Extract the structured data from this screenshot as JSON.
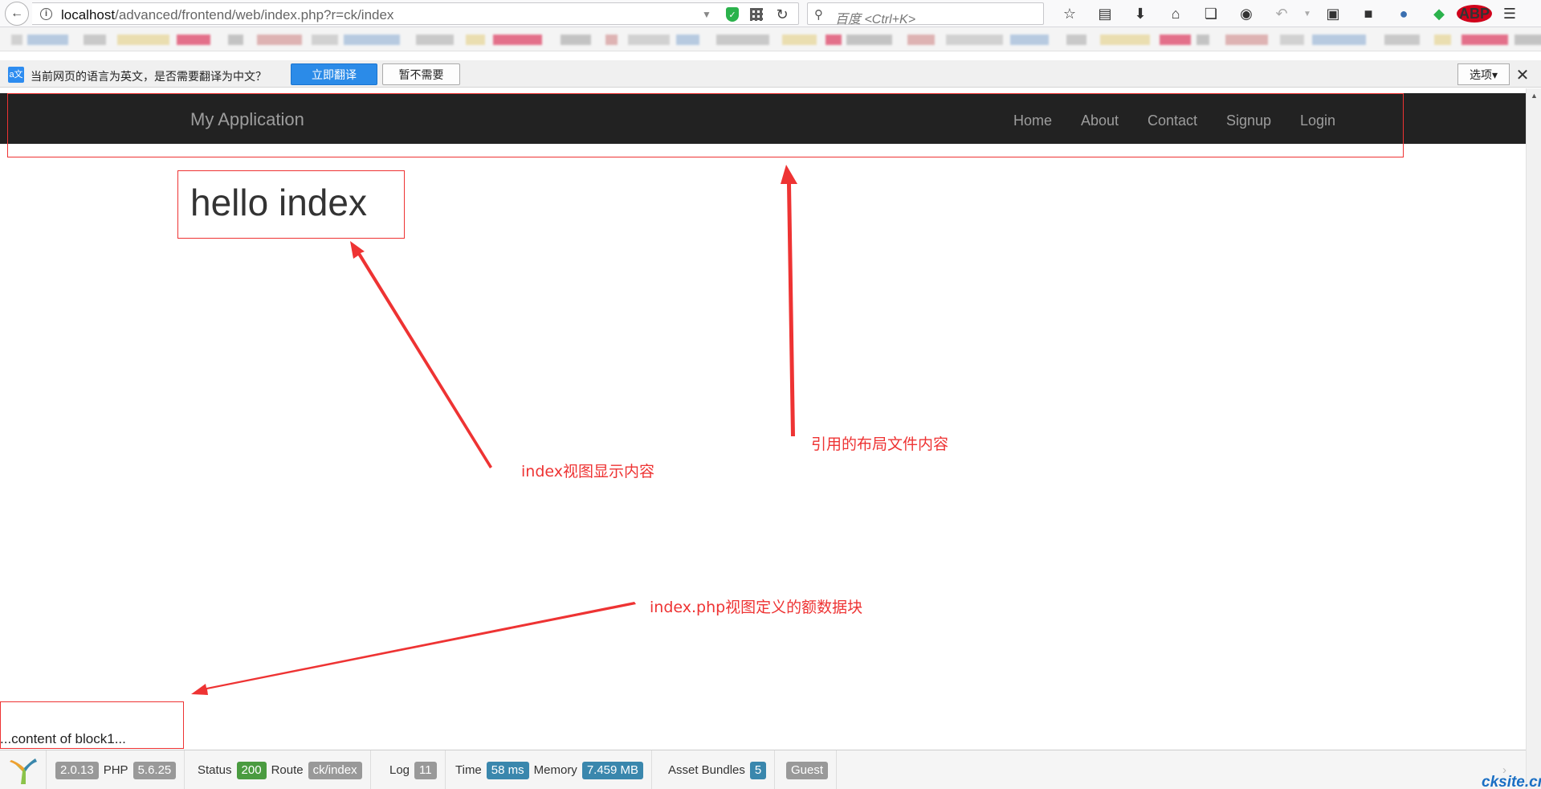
{
  "browser": {
    "url_host": "localhost",
    "url_path": "/advanced/frontend/web/index.php?r=ck/index",
    "search_placeholder": "百度 <Ctrl+K>"
  },
  "translate_bar": {
    "message": "当前网页的语言为英文，是否需要翻译为中文？",
    "translate_button": "立即翻译",
    "decline_button": "暂不需要",
    "options_button": "选项▾"
  },
  "navbar": {
    "brand": "My Application",
    "items": [
      "Home",
      "About",
      "Contact",
      "Signup",
      "Login"
    ]
  },
  "content": {
    "heading": "hello index",
    "block1": "...content of block1..."
  },
  "debug_toolbar": {
    "yii_version": "2.0.13",
    "php_label": "PHP",
    "php_version": "5.6.25",
    "status_label": "Status",
    "status_code": "200",
    "route_label": "Route",
    "route": "ck/index",
    "log_label": "Log",
    "log_count": "11",
    "time_label": "Time",
    "time": "58 ms",
    "memory_label": "Memory",
    "memory": "7.459 MB",
    "asset_label": "Asset Bundles",
    "asset_count": "5",
    "user": "Guest"
  },
  "annotations": {
    "layout_note": "引用的布局文件内容",
    "view_note": "index视图显示内容",
    "block_note": "index.php视图定义的额数据块"
  },
  "watermark": "cksite.cn",
  "colors": {
    "annotation": "#ee3333",
    "navbar_bg": "#222222",
    "nav_text": "#9d9d9d",
    "translate_button": "#2b8be8",
    "status_ok": "#4a9b40",
    "info_label": "#3a87ad"
  },
  "icons": [
    "back-arrow-icon",
    "info-icon",
    "dropdown-arrow-icon",
    "shield-icon",
    "qr-code-icon",
    "reload-icon",
    "search-icon",
    "bookmark-star-icon",
    "reading-list-icon",
    "download-icon",
    "home-icon",
    "crop-icon",
    "chat-icon",
    "undo-icon",
    "reader-view-icon",
    "mask-icon",
    "globe-icon",
    "leaf-icon",
    "adblock-icon",
    "hamburger-menu-icon",
    "translate-icon",
    "close-icon",
    "yii-logo-icon"
  ]
}
